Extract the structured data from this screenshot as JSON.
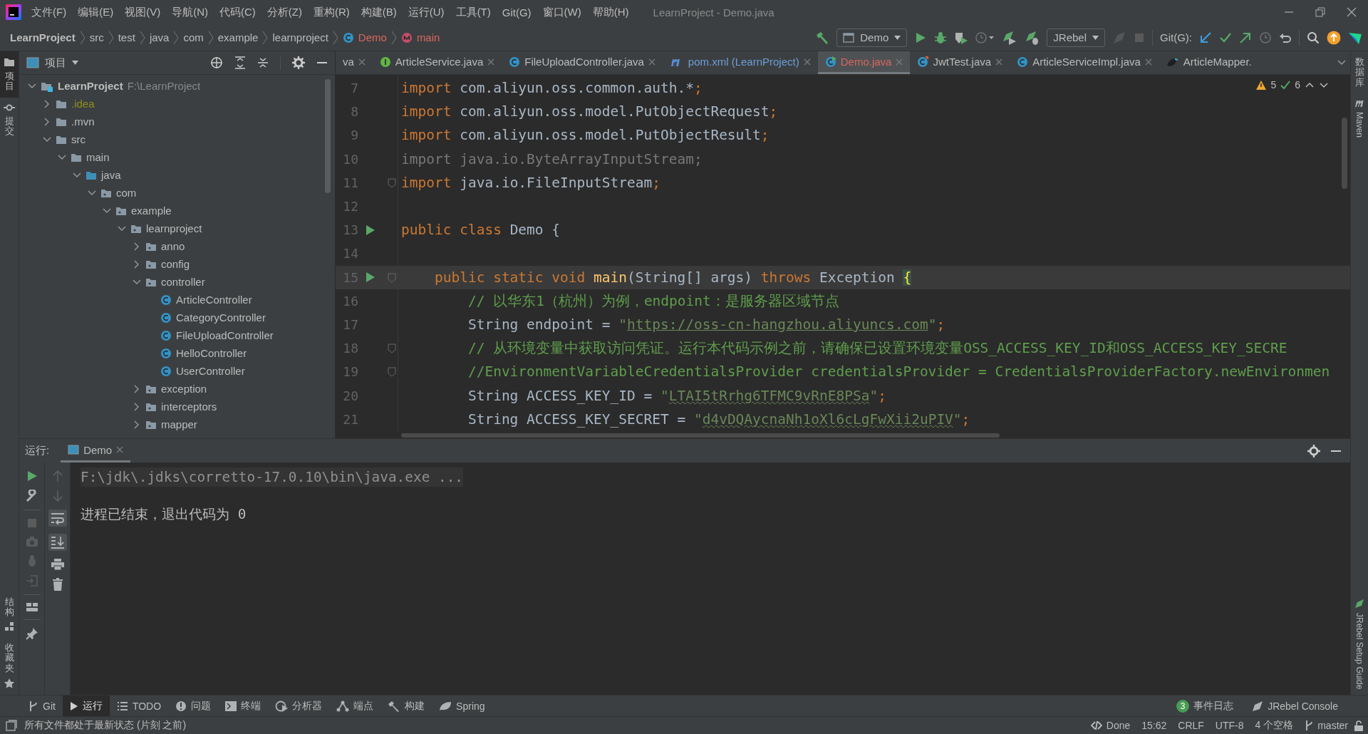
{
  "window": {
    "title": "LearnProject - Demo.java"
  },
  "menu": [
    "文件(F)",
    "编辑(E)",
    "视图(V)",
    "导航(N)",
    "代码(C)",
    "分析(Z)",
    "重构(R)",
    "构建(B)",
    "运行(U)",
    "工具(T)",
    "Git(G)",
    "窗口(W)",
    "帮助(H)"
  ],
  "breadcrumbs": [
    {
      "label": "LearnProject",
      "kind": "project"
    },
    {
      "label": "src",
      "kind": "folder"
    },
    {
      "label": "test",
      "kind": "folder"
    },
    {
      "label": "java",
      "kind": "folder"
    },
    {
      "label": "com",
      "kind": "folder"
    },
    {
      "label": "example",
      "kind": "folder"
    },
    {
      "label": "learnproject",
      "kind": "folder"
    },
    {
      "label": "Demo",
      "kind": "class",
      "color": "#d9675f"
    },
    {
      "label": "main",
      "kind": "method",
      "color": "#d9675f"
    }
  ],
  "toolbar": {
    "run_config": "Demo",
    "jrebel": "JRebel",
    "git_label": "Git(G):"
  },
  "left_stripe_top": [
    {
      "label": "项目",
      "selected": true,
      "kind": "project"
    },
    {
      "label": "提交",
      "selected": false,
      "kind": "commit"
    }
  ],
  "left_stripe_bottom": [
    {
      "label": "结构",
      "selected": false,
      "kind": "structure"
    },
    {
      "label": "收藏夹",
      "selected": false,
      "kind": "favorites"
    }
  ],
  "right_stripe_top": [
    {
      "label": "数据库",
      "kind": "database"
    },
    {
      "label": "Maven",
      "kind": "maven"
    }
  ],
  "right_stripe_bottom": [
    {
      "label": "JRebel Setup Guide",
      "kind": "jrebel"
    }
  ],
  "project": {
    "title": "项目",
    "tree": [
      {
        "name": "LearnProject",
        "path": "F:\\LearnProject",
        "kind": "module",
        "expanded": true,
        "children": [
          {
            "name": ".idea",
            "kind": "ignored-folder",
            "expanded": false
          },
          {
            "name": ".mvn",
            "kind": "folder",
            "expanded": false
          },
          {
            "name": "src",
            "kind": "folder",
            "expanded": true,
            "children": [
              {
                "name": "main",
                "kind": "folder",
                "expanded": true,
                "children": [
                  {
                    "name": "java",
                    "kind": "source-folder",
                    "expanded": true,
                    "children": [
                      {
                        "name": "com",
                        "kind": "package",
                        "expanded": true,
                        "children": [
                          {
                            "name": "example",
                            "kind": "package",
                            "expanded": true,
                            "children": [
                              {
                                "name": "learnproject",
                                "kind": "package",
                                "expanded": true,
                                "children": [
                                  {
                                    "name": "anno",
                                    "kind": "package",
                                    "expanded": false
                                  },
                                  {
                                    "name": "config",
                                    "kind": "package",
                                    "expanded": false
                                  },
                                  {
                                    "name": "controller",
                                    "kind": "package",
                                    "expanded": true,
                                    "children": [
                                      {
                                        "name": "ArticleController",
                                        "kind": "class"
                                      },
                                      {
                                        "name": "CategoryController",
                                        "kind": "class"
                                      },
                                      {
                                        "name": "FileUploadController",
                                        "kind": "class"
                                      },
                                      {
                                        "name": "HelloController",
                                        "kind": "class"
                                      },
                                      {
                                        "name": "UserController",
                                        "kind": "class"
                                      }
                                    ]
                                  },
                                  {
                                    "name": "exception",
                                    "kind": "package",
                                    "expanded": false
                                  },
                                  {
                                    "name": "interceptors",
                                    "kind": "package",
                                    "expanded": false
                                  },
                                  {
                                    "name": "mapper",
                                    "kind": "package",
                                    "expanded": false
                                  }
                                ]
                              }
                            ]
                          }
                        ]
                      }
                    ]
                  }
                ]
              }
            ]
          }
        ]
      }
    ]
  },
  "editor": {
    "tabs": [
      {
        "label": "va",
        "kind": "none",
        "selected": false,
        "color": "#bbbbbb"
      },
      {
        "label": "ArticleService.java",
        "kind": "interface",
        "selected": false,
        "color": "#bbbbbb"
      },
      {
        "label": "FileUploadController.java",
        "kind": "class",
        "selected": false,
        "color": "#bbbbbb"
      },
      {
        "label": "pom.xml (LearnProject)",
        "kind": "maven",
        "selected": false,
        "color": "#6d9ed8"
      },
      {
        "label": "Demo.java",
        "kind": "class-run",
        "selected": true,
        "color": "#d9675f"
      },
      {
        "label": "JwtTest.java",
        "kind": "test",
        "selected": false,
        "color": "#bbbbbb"
      },
      {
        "label": "ArticleServiceImpl.java",
        "kind": "class",
        "selected": false,
        "color": "#bbbbbb"
      },
      {
        "label": "ArticleMapper.",
        "kind": "mapper",
        "selected": false,
        "color": "#bbbbbb"
      }
    ],
    "inspections": {
      "warnings": "5",
      "passed": "6"
    },
    "lines": [
      {
        "number": "7",
        "run": false,
        "fold": false,
        "current": false,
        "tokens": [
          {
            "kind": "keyword",
            "text": "import"
          },
          {
            "kind": "plain",
            "text": " com.aliyun.oss.common.auth.*"
          },
          {
            "kind": "punct",
            "text": ";"
          }
        ]
      },
      {
        "number": "8",
        "run": false,
        "fold": false,
        "current": false,
        "tokens": [
          {
            "kind": "keyword",
            "text": "import"
          },
          {
            "kind": "plain",
            "text": " com.aliyun.oss.model.PutObjectRequest"
          },
          {
            "kind": "punct",
            "text": ";"
          }
        ]
      },
      {
        "number": "9",
        "run": false,
        "fold": false,
        "current": false,
        "tokens": [
          {
            "kind": "keyword",
            "text": "import"
          },
          {
            "kind": "plain",
            "text": " com.aliyun.oss.model.PutObjectResult"
          },
          {
            "kind": "punct",
            "text": ";"
          }
        ]
      },
      {
        "number": "10",
        "run": false,
        "fold": false,
        "current": false,
        "tokens": [
          {
            "kind": "unused",
            "text": "import java.io.ByteArrayInputStream;"
          }
        ]
      },
      {
        "number": "11",
        "run": false,
        "fold": true,
        "current": false,
        "tokens": [
          {
            "kind": "keyword",
            "text": "import"
          },
          {
            "kind": "plain",
            "text": " java.io.FileInputStream"
          },
          {
            "kind": "punct",
            "text": ";"
          }
        ]
      },
      {
        "number": "12",
        "run": false,
        "fold": false,
        "current": false
      },
      {
        "number": "13",
        "run": true,
        "fold": false,
        "current": false,
        "tokens": [
          {
            "kind": "keyword",
            "text": "public class"
          },
          {
            "kind": "plain",
            "text": " Demo {"
          }
        ]
      },
      {
        "number": "14",
        "run": false,
        "fold": false,
        "current": false
      },
      {
        "number": "15",
        "run": true,
        "fold": true,
        "current": true,
        "tokens": [
          {
            "kind": "keyword",
            "text": "    public static void"
          },
          {
            "kind": "method",
            "text": " main"
          },
          {
            "kind": "plain",
            "text": "(String[] args) "
          },
          {
            "kind": "keyword",
            "text": "throws"
          },
          {
            "kind": "plain",
            "text": " Exception "
          },
          {
            "kind": "brace-match",
            "text": "{"
          }
        ]
      },
      {
        "number": "16",
        "run": false,
        "fold": false,
        "current": false,
        "tokens": [
          {
            "kind": "comment",
            "text": "        // 以华东1（杭州）为例，endpoint：是服务器区域节点"
          }
        ]
      },
      {
        "number": "17",
        "run": false,
        "fold": false,
        "current": false,
        "tokens": [
          {
            "kind": "plain",
            "text": "        String endpoint = "
          },
          {
            "kind": "string",
            "text": "\""
          },
          {
            "kind": "link",
            "text": "https://oss-cn-hangzhou.aliyuncs.com"
          },
          {
            "kind": "string",
            "text": "\""
          },
          {
            "kind": "punct",
            "text": ";"
          }
        ]
      },
      {
        "number": "18",
        "run": false,
        "fold": true,
        "current": false,
        "tokens": [
          {
            "kind": "comment",
            "text": "        // 从环境变量中获取访问凭证。运行本代码示例之前，请确保已设置环境变量OSS_ACCESS_KEY_ID和OSS_ACCESS_KEY_SECRE"
          }
        ]
      },
      {
        "number": "19",
        "run": false,
        "fold": true,
        "current": false,
        "tokens": [
          {
            "kind": "comment",
            "text": "        //EnvironmentVariableCredentialsProvider credentialsProvider = CredentialsProviderFactory.newEnvironmen"
          }
        ]
      },
      {
        "number": "20",
        "run": false,
        "fold": false,
        "current": false,
        "tokens": [
          {
            "kind": "plain",
            "text": "        String ACCESS_KEY_ID = "
          },
          {
            "kind": "string",
            "text": "\""
          },
          {
            "kind": "string-typo",
            "text": "LTAI5tRrhg6TFMC9vRnE8PSa"
          },
          {
            "kind": "string",
            "text": "\""
          },
          {
            "kind": "punct",
            "text": ";"
          }
        ]
      },
      {
        "number": "21",
        "run": false,
        "fold": false,
        "current": false,
        "tokens": [
          {
            "kind": "plain",
            "text": "        String ACCESS_KEY_SECRET = "
          },
          {
            "kind": "string",
            "text": "\""
          },
          {
            "kind": "string-typo",
            "text": "d4vDQAycnaNh1oXl6cLgFwXii2uPIV"
          },
          {
            "kind": "string",
            "text": "\""
          },
          {
            "kind": "punct",
            "text": ";"
          }
        ]
      }
    ]
  },
  "run": {
    "label": "运行:",
    "tabs": [
      {
        "label": "Demo",
        "selected": true
      }
    ],
    "console": [
      {
        "kind": "command",
        "text": "F:\\jdk\\.jdks\\corretto-17.0.10\\bin\\java.exe ..."
      },
      {
        "kind": "output",
        "text": "进程已结束，退出代码为 0"
      }
    ]
  },
  "tool_windows": [
    {
      "label": "Git",
      "kind": "git",
      "selected": false
    },
    {
      "label": "运行",
      "kind": "run",
      "selected": true
    },
    {
      "label": "TODO",
      "kind": "todo",
      "selected": false
    },
    {
      "label": "问题",
      "kind": "problems",
      "selected": false
    },
    {
      "label": "终端",
      "kind": "terminal",
      "selected": false
    },
    {
      "label": "分析器",
      "kind": "profiler",
      "selected": false
    },
    {
      "label": "端点",
      "kind": "endpoints",
      "selected": false
    },
    {
      "label": "构建",
      "kind": "build",
      "selected": false
    },
    {
      "label": "Spring",
      "kind": "spring",
      "selected": false
    }
  ],
  "event_log": {
    "count": "3",
    "label": "事件日志"
  },
  "jrebel_console": {
    "label": "JRebel Console"
  },
  "status_bar": {
    "message": "所有文件都处于最新状态 (片刻 之前)",
    "items": [
      {
        "label": "Done",
        "kind": "done"
      },
      {
        "label": "15:62",
        "kind": "text"
      },
      {
        "label": "CRLF",
        "kind": "text"
      },
      {
        "label": "UTF-8",
        "kind": "text"
      },
      {
        "label": "4 个空格",
        "kind": "text"
      },
      {
        "label": "master",
        "kind": "branch"
      }
    ]
  }
}
